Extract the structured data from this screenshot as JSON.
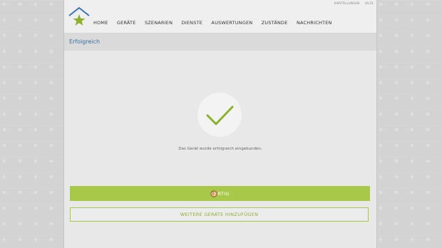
{
  "utility_links": [
    "EINSTELLUNGEN",
    "HILFE"
  ],
  "nav": {
    "items": [
      {
        "label": "HOME"
      },
      {
        "label": "GERÄTE"
      },
      {
        "label": "SZENARIEN"
      },
      {
        "label": "DIENSTE"
      },
      {
        "label": "AUSWERTUNGEN"
      },
      {
        "label": "ZUSTÄNDE"
      },
      {
        "label": "NACHRICHTEN"
      }
    ]
  },
  "page": {
    "title": "Erfolgreich",
    "message": "Das Gerät wurde erfolgreich eingebunden.",
    "primary_button": "FERTIG",
    "primary_button_visible": "RTIG",
    "secondary_button": "WEITERE GERÄTE HINZUFÜGEN"
  },
  "colors": {
    "accent_green": "#a8c84a",
    "check_green": "#8ab02e",
    "title_blue": "#3a6fa5",
    "logo_blue": "#3b73b0"
  },
  "icons": {
    "logo": "house-star-icon",
    "check": "checkmark-icon",
    "cursor": "hand-cursor-icon"
  }
}
